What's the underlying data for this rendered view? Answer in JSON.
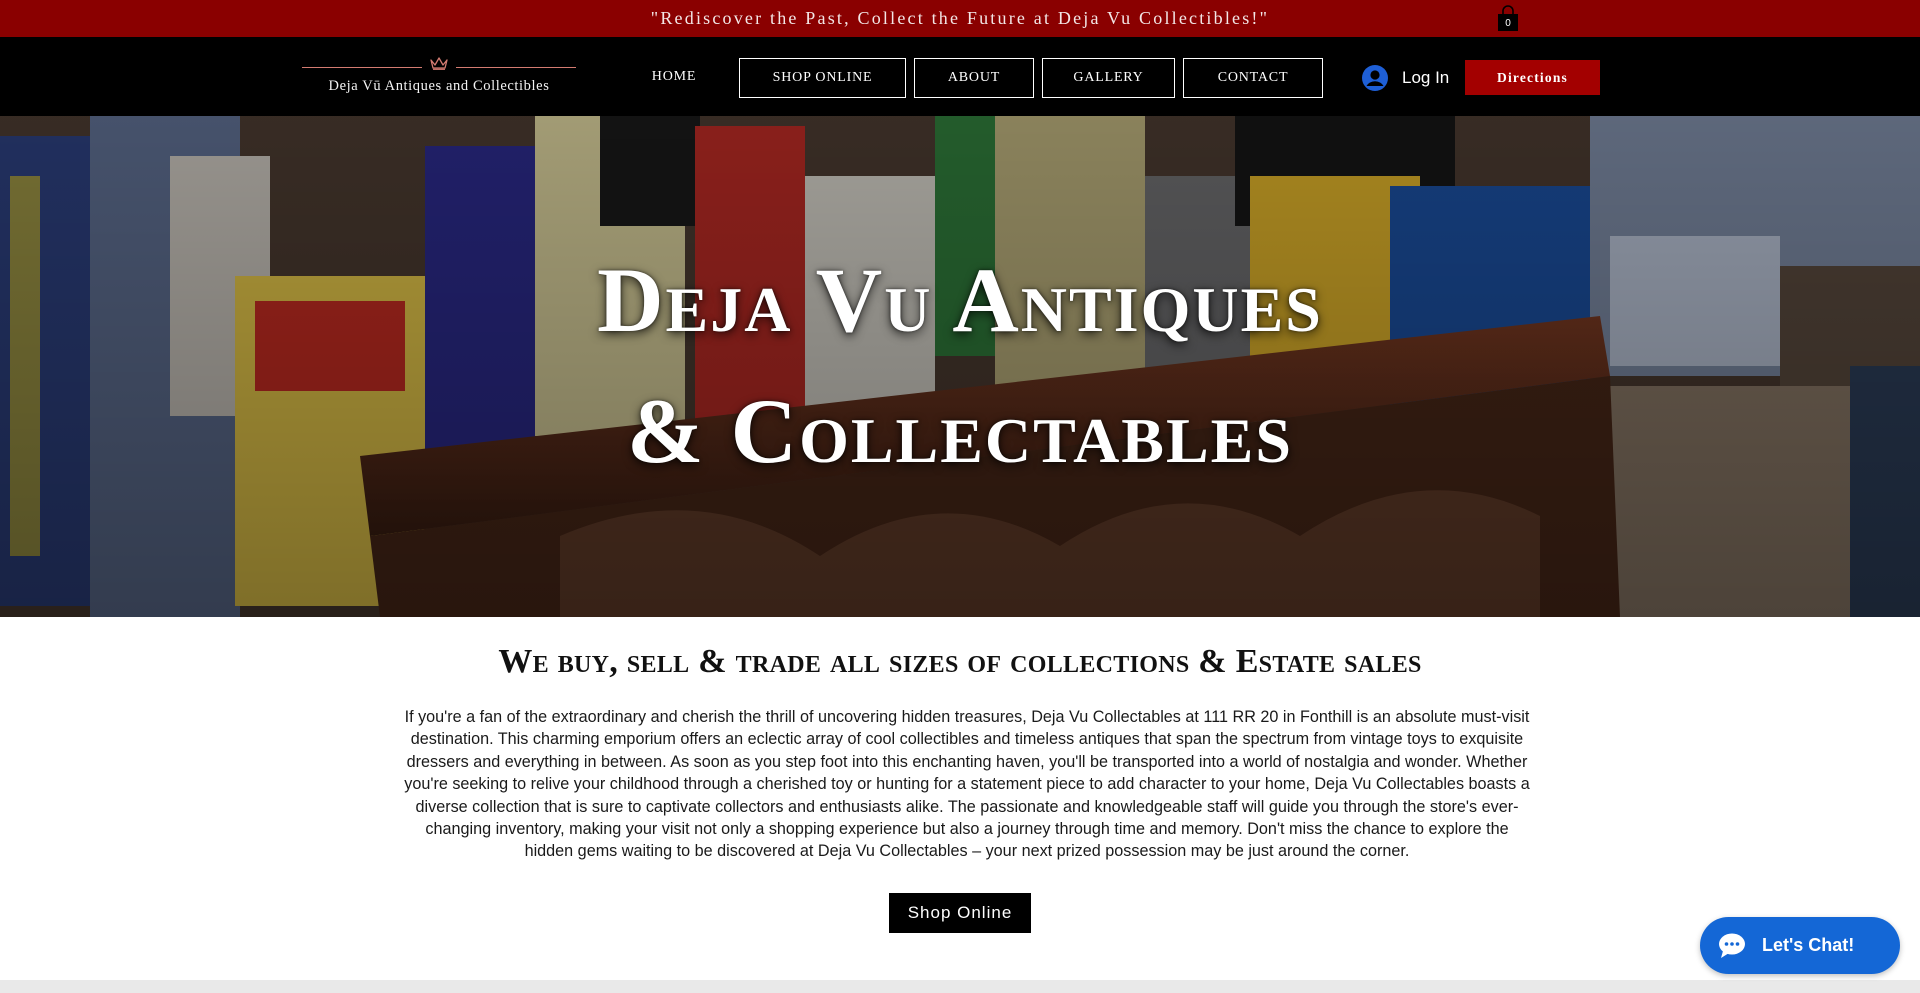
{
  "announcement": {
    "text": "\"Rediscover the Past, Collect the Future at Deja Vu Collectibles!\"",
    "cart_count": "0"
  },
  "header": {
    "brand_name": "Deja Vū Antiques and Collectibles",
    "nav": [
      {
        "label": "HOME",
        "boxed": false
      },
      {
        "label": "SHOP ONLINE",
        "boxed": true
      },
      {
        "label": "ABOUT",
        "boxed": true
      },
      {
        "label": "GALLERY",
        "boxed": true
      },
      {
        "label": "CONTACT",
        "boxed": true
      }
    ],
    "login_label": "Log In",
    "directions_label": "Directions"
  },
  "hero": {
    "title_line1": "Deja Vu Antiques",
    "title_line2": "& Collectables"
  },
  "content": {
    "heading": "We buy, sell & trade all sizes of collections & Estate sales",
    "paragraph": "If you're a fan of the extraordinary and cherish the thrill of uncovering hidden treasures, Deja Vu Collectables at 111 RR 20 in Fonthill is an absolute must-visit destination. This charming emporium offers an eclectic array of cool collectibles and timeless antiques that span the spectrum from vintage toys to exquisite dressers and everything in between. As soon as you step foot into this enchanting haven, you'll be transported into a world of nostalgia and wonder. Whether you're seeking to relive your childhood through a cherished toy or hunting for a statement piece to add character to your home, Deja Vu Collectables boasts a diverse collection that is sure to captivate collectors and enthusiasts alike. The passionate and knowledgeable staff will guide you through the store's ever-changing inventory, making your visit not only a shopping experience but also a journey through time and memory. Don't miss the chance to explore the hidden gems waiting to be discovered at Deja Vu Collectables – your next prized possession may be just around the corner.",
    "shop_button": "Shop Online"
  },
  "chat": {
    "label": "Let's Chat!"
  },
  "colors": {
    "announcement_bg": "#8a0000",
    "header_bg": "#000000",
    "directions_bg": "#a30000",
    "chat_bg": "#1467d6",
    "brand_accent": "#d37b71"
  },
  "icons": [
    "shopping-bag-icon",
    "crown-icon",
    "user-avatar-icon",
    "chat-bubble-icon"
  ]
}
